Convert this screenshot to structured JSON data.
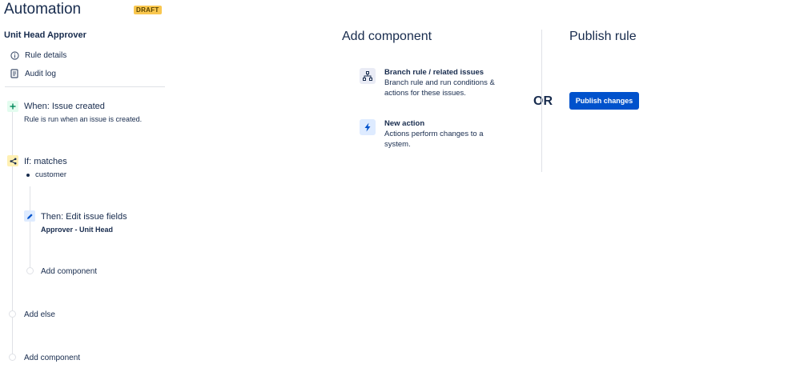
{
  "header": {
    "title": "Automation",
    "badge": "DRAFT"
  },
  "rule": {
    "name": "Unit Head Approver"
  },
  "nav": {
    "rule_details": "Rule details",
    "audit_log": "Audit log"
  },
  "flow": {
    "trigger": {
      "title": "When: Issue created",
      "subtitle": "Rule is run when an issue is created.",
      "icon": "plus-icon",
      "color": "#e3fcef"
    },
    "condition": {
      "title": "If: matches",
      "values": [
        "customer"
      ],
      "icon": "branch-icon",
      "color": "#fff0b3"
    },
    "action": {
      "title": "Then: Edit issue fields",
      "detail": "Approver - Unit Head",
      "icon": "pencil-icon",
      "color": "#deebff"
    },
    "add_inner": "Add component",
    "add_else": "Add else",
    "add_outer": "Add component"
  },
  "add_panel": {
    "title": "Add component",
    "options": [
      {
        "title": "Branch rule / related issues",
        "desc": "Branch rule and run conditions & actions for these issues.",
        "icon": "hierarchy-icon"
      },
      {
        "title": "New action",
        "desc": "Actions perform changes to a system.",
        "icon": "lightning-icon"
      }
    ]
  },
  "or_label": "OR",
  "publish_panel": {
    "title": "Publish rule",
    "button": "Publish changes"
  },
  "colors": {
    "primary": "#0052cc",
    "text": "#172b4d",
    "draft": "#f9c74f"
  }
}
